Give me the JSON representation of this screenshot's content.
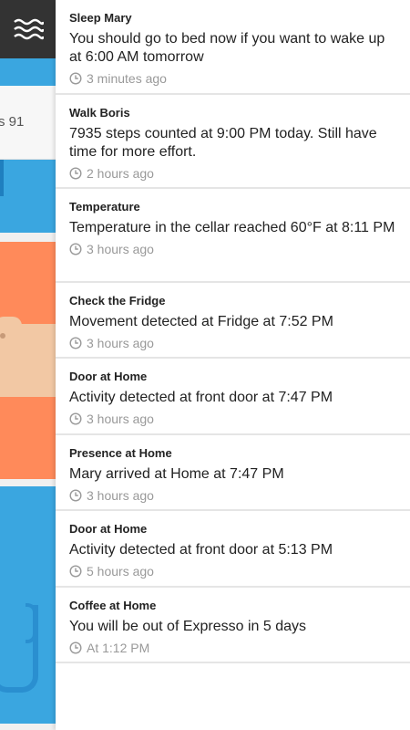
{
  "background_app": {
    "menu_icon": "wave-menu-icon",
    "partial_count_text": "s 91",
    "colors": {
      "header": "#333333",
      "blue": "#3aa6e0",
      "orange": "#ff8a5a",
      "peach": "#f2c8a4"
    }
  },
  "notifications": [
    {
      "title": "Sleep Mary",
      "body": "You should go to bed now if you want to wake up at 6:00 AM tomorrow",
      "time": "3 minutes ago"
    },
    {
      "title": "Walk Boris",
      "body": "7935 steps counted at 9:00 PM today. Still have time for more effort.",
      "time": "2 hours ago"
    },
    {
      "title": "Temperature",
      "body": "Temperature in the cellar reached 60°F at 8:11 PM",
      "time": "3 hours ago"
    },
    {
      "title": "Check the Fridge",
      "body": "Movement detected at Fridge at 7:52 PM",
      "time": "3 hours ago"
    },
    {
      "title": "Door at Home",
      "body": "Activity detected at front door at 7:47 PM",
      "time": "3 hours ago"
    },
    {
      "title": "Presence at Home",
      "body": "Mary arrived at Home at 7:47 PM",
      "time": "3 hours ago"
    },
    {
      "title": "Door at Home",
      "body": "Activity detected at front door at 5:13 PM",
      "time": "5 hours ago"
    },
    {
      "title": "Coffee at Home",
      "body": "You will be out of Expresso in 5 days",
      "time": "At 1:12 PM"
    }
  ]
}
